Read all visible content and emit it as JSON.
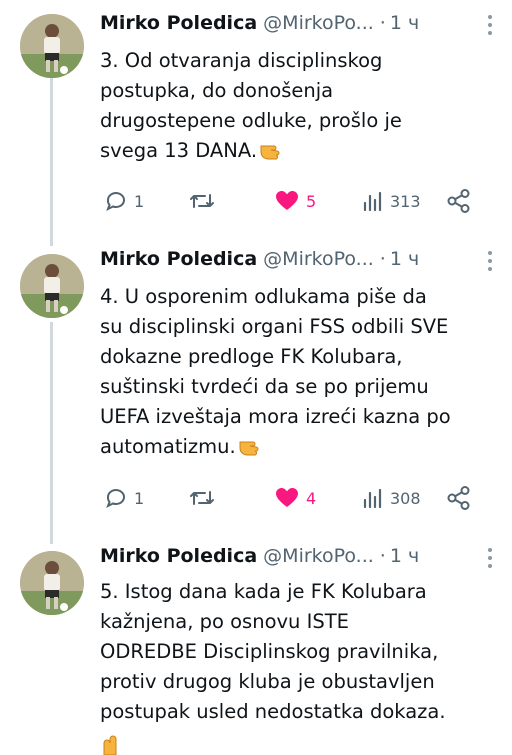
{
  "tweets": [
    {
      "author": "Mirko Poledica",
      "handle": "@MirkoPo...",
      "dot": "·",
      "time": "1 ч",
      "lines": [
        "3. Od otvaranja disciplinskog",
        "postupka, do donošenja",
        "drugostepene odluke, prošlo je",
        "svega 13 DANA."
      ],
      "replies": "1",
      "retweets": "",
      "likes": "5",
      "views": "313"
    },
    {
      "author": "Mirko Poledica",
      "handle": "@MirkoPo...",
      "dot": "·",
      "time": "1 ч",
      "lines": [
        "4. U osporenim odlukama  piše da",
        "su disciplinski organi FSS odbili SVE",
        "dokazne predloge FK Kolubara,",
        "suštinski tvrdeći da se po prijemu",
        "UEFA izveštaja mora izreći kazna po",
        "automatizmu."
      ],
      "replies": "1",
      "retweets": "",
      "likes": "4",
      "views": "308"
    },
    {
      "author": "Mirko Poledica",
      "handle": "@MirkoPo...",
      "dot": "·",
      "time": "1 ч",
      "lines": [
        "5. Istog dana kada je FK Kolubara",
        "kažnjena, po osnovu ISTE",
        "ODREDBE Disciplinskog pravilnika,",
        "protiv drugog kluba je obustavljen",
        "postupak usled nedostatka dokaza."
      ]
    }
  ],
  "colors": {
    "like": "#f91880",
    "muted": "#536471",
    "text": "#0f1419",
    "thread": "#cfd9de"
  },
  "icons": [
    "avatar",
    "more-icon",
    "reply-icon",
    "retweet-icon",
    "like-icon",
    "views-icon",
    "share-icon",
    "pointing-hand-emoji"
  ]
}
